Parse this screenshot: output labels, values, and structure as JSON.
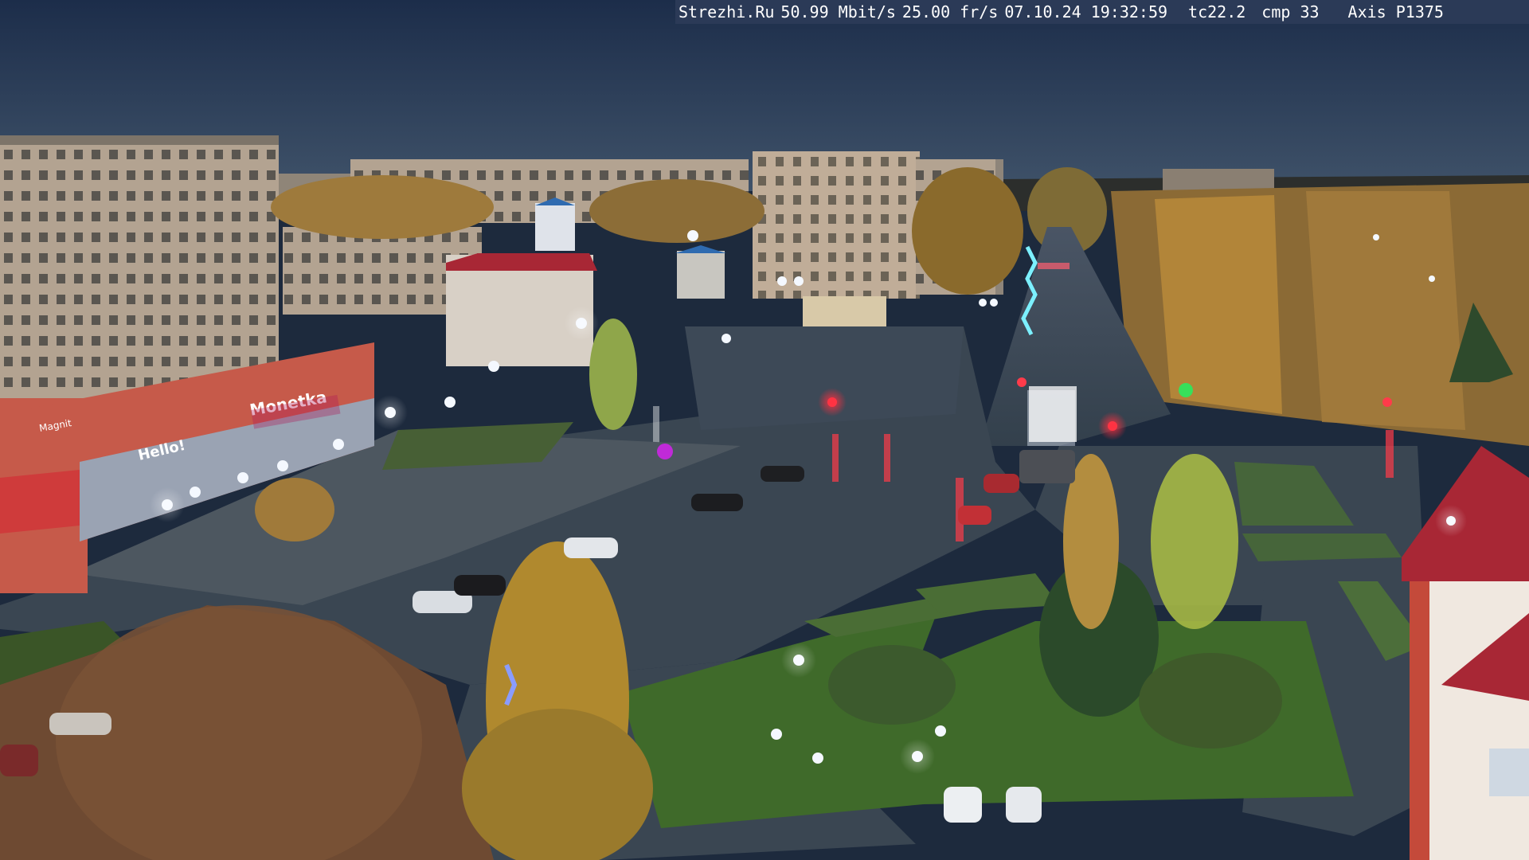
{
  "camera_overlay": {
    "site": "Strezhi.Ru",
    "bitrate": "50.99 Mbit/s",
    "framerate": "25.00 fr/s",
    "datetime": "07.10.24 19:32:59",
    "tc": "tc22.2",
    "cmp": "cmp 33",
    "camera_model": "Axis P1375"
  },
  "store_signs": {
    "sign_main": "Monetka",
    "sign_secondary": "Hello!",
    "sign_small": "Magnit"
  },
  "colors": {
    "sky_top": "#1c2d4a",
    "sky_horizon": "#3f5269",
    "asphalt": "#3a4652",
    "grass": "#3f6a2a",
    "building_brick": "#b0a08f",
    "storefront": "#c65a4a",
    "red_roof": "#a82735",
    "autumn_tree": "#b98a3a"
  }
}
